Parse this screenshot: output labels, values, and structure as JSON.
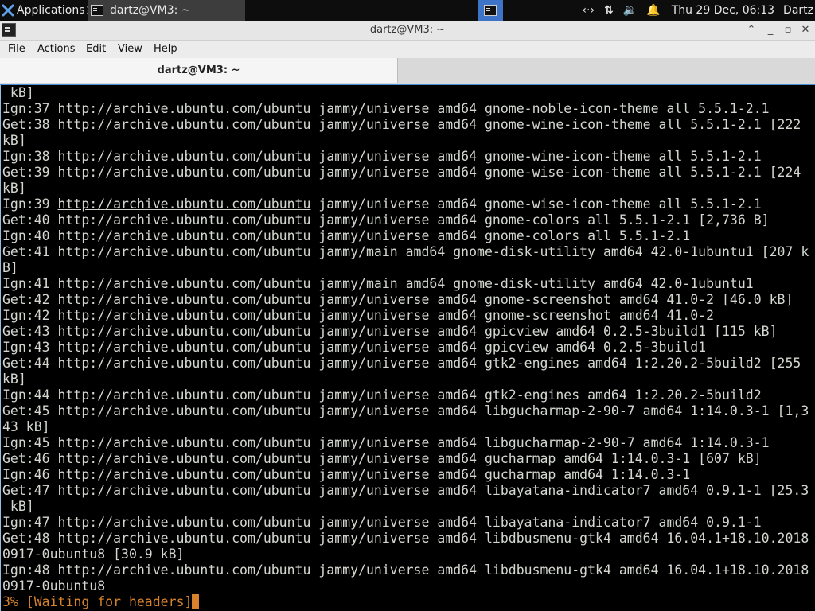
{
  "panel": {
    "applications_label": "Applications",
    "task_label": "dartz@VM3: ~",
    "clock": "Thu 29 Dec, 06:13",
    "user": "Dartz"
  },
  "window": {
    "title": "dartz@VM3: ~",
    "menu": [
      "File",
      "Actions",
      "Edit",
      "View",
      "Help"
    ],
    "tab_label": "dartz@VM3: ~"
  },
  "terminal": {
    "lines": [
      " kB]",
      "Ign:37 http://archive.ubuntu.com/ubuntu jammy/universe amd64 gnome-noble-icon-theme all 5.5.1-2.1",
      "Get:38 http://archive.ubuntu.com/ubuntu jammy/universe amd64 gnome-wine-icon-theme all 5.5.1-2.1 [222",
      "kB]",
      "Ign:38 http://archive.ubuntu.com/ubuntu jammy/universe amd64 gnome-wine-icon-theme all 5.5.1-2.1",
      "Get:39 http://archive.ubuntu.com/ubuntu jammy/universe amd64 gnome-wise-icon-theme all 5.5.1-2.1 [224",
      "kB]",
      "Ign:39 http://archive.ubuntu.com/ubuntu jammy/universe amd64 gnome-wise-icon-theme all 5.5.1-2.1",
      "Get:40 http://archive.ubuntu.com/ubuntu jammy/universe amd64 gnome-colors all 5.5.1-2.1 [2,736 B]",
      "Ign:40 http://archive.ubuntu.com/ubuntu jammy/universe amd64 gnome-colors all 5.5.1-2.1",
      "Get:41 http://archive.ubuntu.com/ubuntu jammy/main amd64 gnome-disk-utility amd64 42.0-1ubuntu1 [207 k",
      "B]",
      "Ign:41 http://archive.ubuntu.com/ubuntu jammy/main amd64 gnome-disk-utility amd64 42.0-1ubuntu1",
      "Get:42 http://archive.ubuntu.com/ubuntu jammy/universe amd64 gnome-screenshot amd64 41.0-2 [46.0 kB]",
      "Ign:42 http://archive.ubuntu.com/ubuntu jammy/universe amd64 gnome-screenshot amd64 41.0-2",
      "Get:43 http://archive.ubuntu.com/ubuntu jammy/universe amd64 gpicview amd64 0.2.5-3build1 [115 kB]",
      "Ign:43 http://archive.ubuntu.com/ubuntu jammy/universe amd64 gpicview amd64 0.2.5-3build1",
      "Get:44 http://archive.ubuntu.com/ubuntu jammy/universe amd64 gtk2-engines amd64 1:2.20.2-5build2 [255",
      "kB]",
      "Ign:44 http://archive.ubuntu.com/ubuntu jammy/universe amd64 gtk2-engines amd64 1:2.20.2-5build2",
      "Get:45 http://archive.ubuntu.com/ubuntu jammy/universe amd64 libgucharmap-2-90-7 amd64 1:14.0.3-1 [1,3",
      "43 kB]",
      "Ign:45 http://archive.ubuntu.com/ubuntu jammy/universe amd64 libgucharmap-2-90-7 amd64 1:14.0.3-1",
      "Get:46 http://archive.ubuntu.com/ubuntu jammy/universe amd64 gucharmap amd64 1:14.0.3-1 [607 kB]",
      "Ign:46 http://archive.ubuntu.com/ubuntu jammy/universe amd64 gucharmap amd64 1:14.0.3-1",
      "Get:47 http://archive.ubuntu.com/ubuntu jammy/universe amd64 libayatana-indicator7 amd64 0.9.1-1 [25.3",
      " kB]",
      "Ign:47 http://archive.ubuntu.com/ubuntu jammy/universe amd64 libayatana-indicator7 amd64 0.9.1-1",
      "Get:48 http://archive.ubuntu.com/ubuntu jammy/universe amd64 libdbusmenu-gtk4 amd64 16.04.1+18.10.2018",
      "0917-0ubuntu8 [30.9 kB]",
      "Ign:48 http://archive.ubuntu.com/ubuntu jammy/universe amd64 libdbusmenu-gtk4 amd64 16.04.1+18.10.2018",
      "0917-0ubuntu8"
    ],
    "status": "3% [Waiting for headers]"
  },
  "colors": {
    "accent": "#3e74c7",
    "status": "#d7822d",
    "text": "#d3d7cf"
  }
}
